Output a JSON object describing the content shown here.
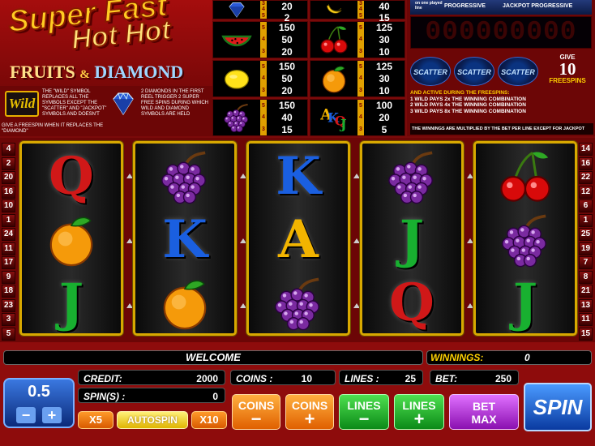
{
  "logo": {
    "line1": "Super Fast",
    "line2": "Hot Hot",
    "line3a": "FRUITS",
    "amp": "&",
    "line3b": "DIAMOND"
  },
  "rules": {
    "wild_badge": "Wild",
    "wild_text": "THE \"WILD\" SYMBOL REPLACES ALL THE SYMBOLS EXCEPT THE \"SCATTER\" AND \"JACKPOT\" SYMBOLS AND DOESN'T",
    "wild_text2": "GIVE A FREESPIN WHEN IT REPLACES THE \"DIAMOND\"",
    "diamond_text": "2 DIAMONDS IN THE FIRST REEL TRIGGER 2 SUPER FREE SPINS DURING WHICH WILD AND DIAMOND SYMBOLS ARE HELD"
  },
  "paytable": [
    {
      "symbol": "diamond-icon",
      "counts": [
        "3",
        "4",
        "5"
      ],
      "values": [
        "20",
        "2"
      ]
    },
    {
      "symbol": "banana-icon",
      "counts": [
        "3",
        "4",
        "5"
      ],
      "values": [
        "40",
        "15"
      ]
    },
    {
      "symbol": "watermelon-icon",
      "counts": [
        "5",
        "4",
        "3"
      ],
      "values": [
        "150",
        "50",
        "20"
      ]
    },
    {
      "symbol": "cherry-icon",
      "counts": [
        "5",
        "4",
        "3"
      ],
      "values": [
        "125",
        "30",
        "10"
      ]
    },
    {
      "symbol": "lemon-icon",
      "counts": [
        "5",
        "4",
        "3"
      ],
      "values": [
        "150",
        "50",
        "20"
      ]
    },
    {
      "symbol": "orange-icon",
      "counts": [
        "5",
        "4",
        "3"
      ],
      "values": [
        "125",
        "30",
        "10"
      ]
    },
    {
      "symbol": "grapes-icon",
      "counts": [
        "5",
        "4",
        "3"
      ],
      "values": [
        "150",
        "40",
        "15"
      ]
    },
    {
      "symbol": "akqj-icon",
      "counts": [
        "5",
        "4",
        "3"
      ],
      "values": [
        "100",
        "20",
        "5"
      ]
    }
  ],
  "jackpot": {
    "once_played": "on one played line",
    "progressive": "PROGRESSIVE",
    "jackpot_progressive": "JACKPOT PROGRESSIVE",
    "meter": "000000000",
    "scatter": "SCATTER",
    "give": "GIVE",
    "give_num": "10",
    "freespins": "FREESPINS",
    "fs_head": "AND ACTIVE DURING THE FREESPINS:",
    "fs1": "1 WILD PAYS 2x THE WINNING COMBINATION",
    "fs2": "2 WILD PAYS 4x THE WINNING COMBINATION",
    "fs3": "3 WILD PAYS 8x THE WINNING COMBINATION",
    "note": "THE WINNINGS ARE MULTIPLIED BY THE BET PER LINE EXCEPT FOR JACKPOT"
  },
  "left_lines": [
    "4",
    "2",
    "20",
    "16",
    "10",
    "1",
    "24",
    "11",
    "17",
    "9",
    "18",
    "23",
    "3",
    "5"
  ],
  "right_lines": [
    "14",
    "16",
    "22",
    "12",
    "6",
    "1",
    "25",
    "19",
    "7",
    "8",
    "21",
    "13",
    "11",
    "15"
  ],
  "reels": [
    [
      "Q",
      "orange",
      "J"
    ],
    [
      "grapes",
      "K",
      "orange"
    ],
    [
      "K",
      "A",
      "grapes"
    ],
    [
      "grapes",
      "J",
      "Q"
    ],
    [
      "cherry",
      "grapes",
      "J"
    ]
  ],
  "colors": {
    "Q": "#d01818",
    "K": "#1a5fe0",
    "A": "#f2b400",
    "J": "#18b030"
  },
  "status": {
    "welcome": "WELCOME",
    "winnings_label": "WINNINGS:",
    "winnings": "0"
  },
  "coin": {
    "value": "0.5",
    "minus": "−",
    "plus": "+"
  },
  "fields": {
    "credit_label": "CREDIT:",
    "credit": "2000",
    "spins_label": "SPIN(S) :",
    "spins": "0",
    "coins_label": "COINS :",
    "coins": "10",
    "lines_label": "LINES :",
    "lines": "25",
    "bet_label": "BET:",
    "bet": "250"
  },
  "buttons": {
    "x5": "X5",
    "autospin": "AUTOSPIN",
    "x10": "X10",
    "coins": "COINS",
    "lines": "LINES",
    "bet": "BET",
    "max": "MAX",
    "spin": "SPIN",
    "minus": "−",
    "plus": "+"
  }
}
